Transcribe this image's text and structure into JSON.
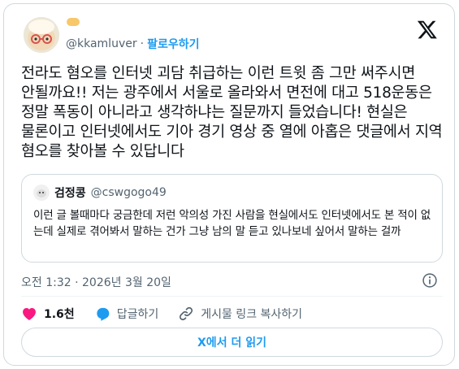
{
  "author": {
    "username": "@kkamluver",
    "follow_label": "팔로우하기",
    "separator": "·"
  },
  "tweet": {
    "text": "전라도 혐오를 인터넷 괴담 취급하는 이런 트윗 좀 그만 써주시면 안될까요!! 저는 광주에서 서울로 올라와서 면전에 대고 518운동은 정말 폭동이 아니라고 생각하냐는 질문까지 들었습니다! 현실은 물론이고 인터넷에서도 기아 경기 영상 중 열에 아홉은 댓글에서 지역 혐오를 찾아볼 수 있답니다",
    "timestamp": "오전 1:32 · 2026년 3월 20일"
  },
  "quote": {
    "name": "검정콩",
    "handle": "@cswgogo49",
    "text": "이런 글 볼때마다 궁금한데 저런 악의성 가진 사람을 현실에서도 인터넷에서도 본 적이 없는데 실제로 겪어봐서 말하는 건가 그냥 남의 말 듣고 있나보네 싶어서 말하는 걸까"
  },
  "actions": {
    "like_count": "1.6천",
    "reply_label": "답글하기",
    "copy_label": "게시물 링크 복사하기",
    "read_more_label": "X에서 더 읽기"
  },
  "icons": [
    "avatar",
    "x-logo-icon",
    "info-icon",
    "heart-icon",
    "reply-icon",
    "link-icon"
  ],
  "colors": {
    "accent": "#1d9bf0",
    "like": "#f91880",
    "muted": "#536471",
    "border": "#cfd9de"
  }
}
